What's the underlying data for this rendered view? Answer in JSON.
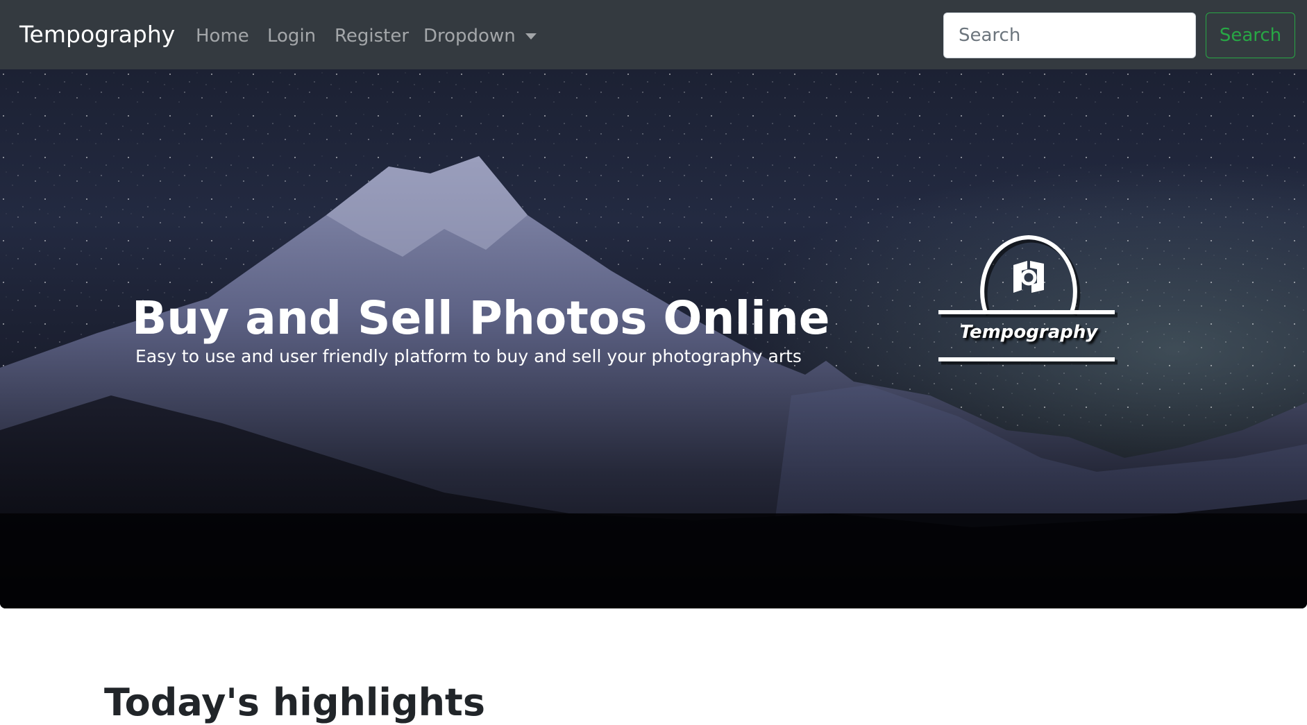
{
  "navbar": {
    "brand": "Tempography",
    "links": [
      {
        "label": "Home"
      },
      {
        "label": "Login"
      },
      {
        "label": "Register"
      },
      {
        "label": "Dropdown",
        "icon": "caret-down-icon"
      }
    ],
    "search": {
      "placeholder": "Search",
      "value": "",
      "button_label": "Search"
    },
    "colors": {
      "background": "#343a40",
      "search_accent": "#28a745"
    }
  },
  "hero": {
    "title": "Buy and Sell Photos Online",
    "subtitle": "Easy to use and user friendly platform to buy and sell your photography arts",
    "background": "night-sky-mountain-photo",
    "logo": {
      "icon": "camera-logo-icon",
      "text": "Tempography"
    }
  },
  "section": {
    "heading": "Today's highlights"
  }
}
